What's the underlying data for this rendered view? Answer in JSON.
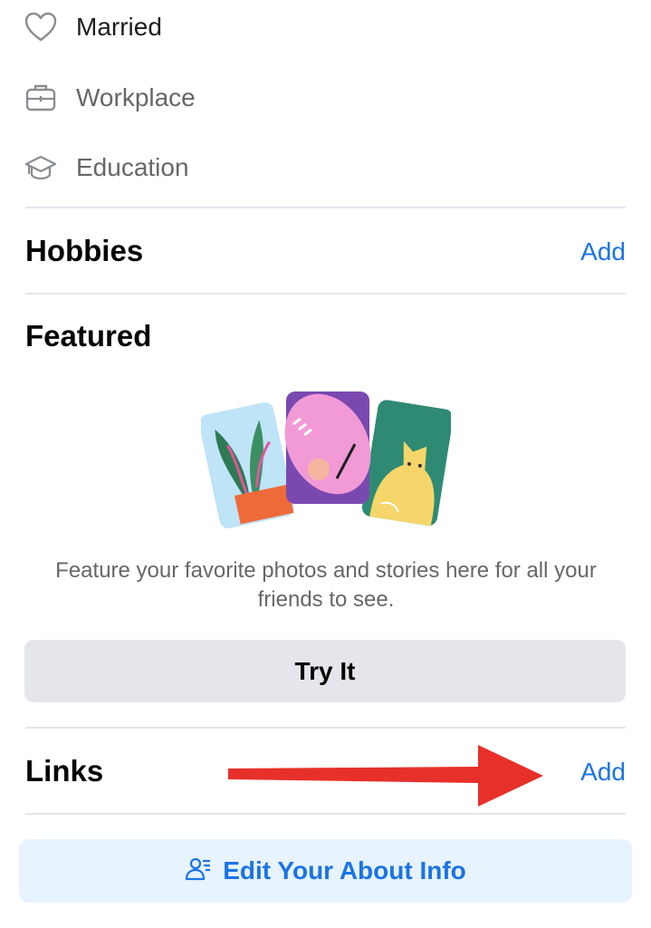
{
  "intro_items": [
    {
      "label": "Married",
      "icon": "heart-icon"
    },
    {
      "label": "Workplace",
      "icon": "briefcase-icon"
    },
    {
      "label": "Education",
      "icon": "graduation-cap-icon"
    }
  ],
  "hobbies": {
    "title": "Hobbies",
    "add_label": "Add"
  },
  "featured": {
    "title": "Featured",
    "description": "Feature your favorite photos and stories here for all your friends to see.",
    "button_label": "Try It"
  },
  "links": {
    "title": "Links",
    "add_label": "Add"
  },
  "edit_button": {
    "label": "Edit Your About Info",
    "icon": "person-list-icon"
  },
  "colors": {
    "accent": "#1b74e4",
    "annotation_arrow": "#e8302a",
    "secondary_button": "#e4e6eb",
    "primary_soft": "#e7f3ff"
  }
}
